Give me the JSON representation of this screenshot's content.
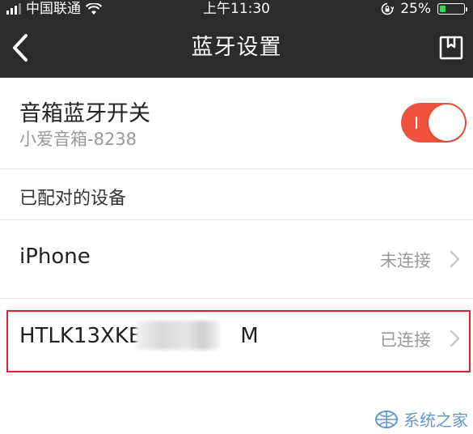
{
  "status_bar": {
    "carrier": "中国联通",
    "time": "上午11:30",
    "battery_percent": "25%",
    "battery_level": 0.25,
    "battery_color": "#3ad35e"
  },
  "nav": {
    "title": "蓝牙设置",
    "back_icon": "chevron-left-icon",
    "right_icon": "bookmark-icon"
  },
  "bluetooth": {
    "title": "音箱蓝牙开关",
    "device_name": "小爱音箱-8238",
    "enabled": true,
    "accent": "#f0523e"
  },
  "paired": {
    "section_label": "已配对的设备",
    "devices": [
      {
        "name": "iPhone",
        "status": "未连接"
      },
      {
        "name_prefix": "HTLK13XKB2",
        "name_suffix": "M",
        "status": "已连接"
      }
    ]
  },
  "watermark": {
    "text": "系统之家"
  },
  "colors": {
    "bar": "#2b2b2b",
    "highlight": "#d9242b"
  }
}
